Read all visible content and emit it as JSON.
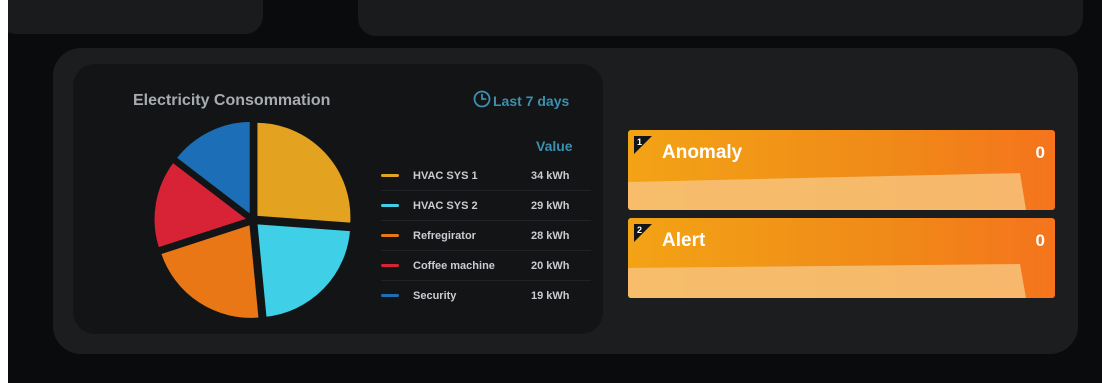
{
  "widget": {
    "title": "Electricity Consommation",
    "period_label": "Last 7 days",
    "value_header": "Value",
    "items": [
      {
        "name": "HVAC SYS 1",
        "value": "34 kWh",
        "kwh": 34,
        "color": "#e3a21f"
      },
      {
        "name": "HVAC SYS 2",
        "value": "29 kWh",
        "kwh": 29,
        "color": "#3fcfe6"
      },
      {
        "name": "Refregirator",
        "value": "28 kWh",
        "kwh": 28,
        "color": "#ea7716"
      },
      {
        "name": "Coffee machine",
        "value": "20 kWh",
        "kwh": 20,
        "color": "#d82336"
      },
      {
        "name": "Security",
        "value": "19 kWh",
        "kwh": 19,
        "color": "#1c6fb6"
      }
    ]
  },
  "kpis": [
    {
      "rank": "1",
      "label": "Anomaly",
      "count": "0"
    },
    {
      "rank": "2",
      "label": "Alert",
      "count": "0"
    }
  ],
  "top_card_colors": [
    "#f0a020",
    "#5cc06a",
    "#ffffff"
  ]
}
